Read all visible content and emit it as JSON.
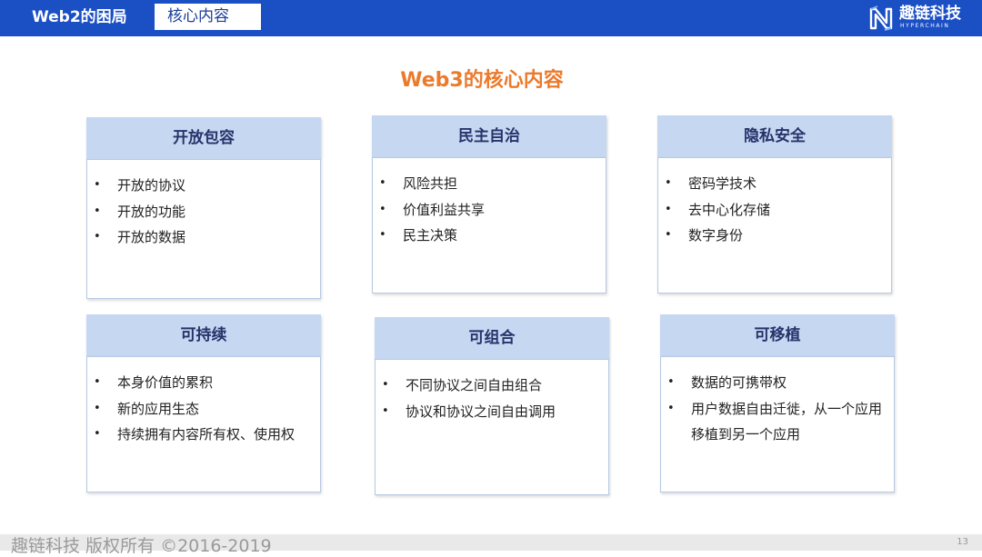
{
  "header": {
    "title": "Web2的困局",
    "tab": "核心内容",
    "logo_text": "趣链科技",
    "logo_sub": "HYPERCHAIN"
  },
  "main": {
    "title": "Web3的核心内容",
    "cards": [
      {
        "title": "开放包容",
        "items": [
          "开放的协议",
          "开放的功能",
          "开放的数据"
        ]
      },
      {
        "title": "民主自治",
        "items": [
          "风险共担",
          "价值利益共享",
          "民主决策"
        ]
      },
      {
        "title": "隐私安全",
        "items": [
          "密码学技术",
          "去中心化存储",
          "数字身份"
        ]
      },
      {
        "title": "可持续",
        "items": [
          "本身价值的累积",
          "新的应用生态",
          "持续拥有内容所有权、使用权"
        ]
      },
      {
        "title": "可组合",
        "items": [
          "不同协议之间自由组合",
          "协议和协议之间自由调用"
        ]
      },
      {
        "title": "可移植",
        "items": [
          "数据的可携带权",
          "用户数据自由迁徙，从一个应用移植到另一个应用"
        ]
      }
    ]
  },
  "footer": {
    "copyright": "趣链科技 版权所有 ©2016-2019",
    "page_number": "13"
  },
  "colors": {
    "header_bg": "#1b4fc4",
    "title_orange": "#ec7a2b",
    "card_header_bg": "#c6d7f1",
    "card_header_text": "#27336b"
  }
}
